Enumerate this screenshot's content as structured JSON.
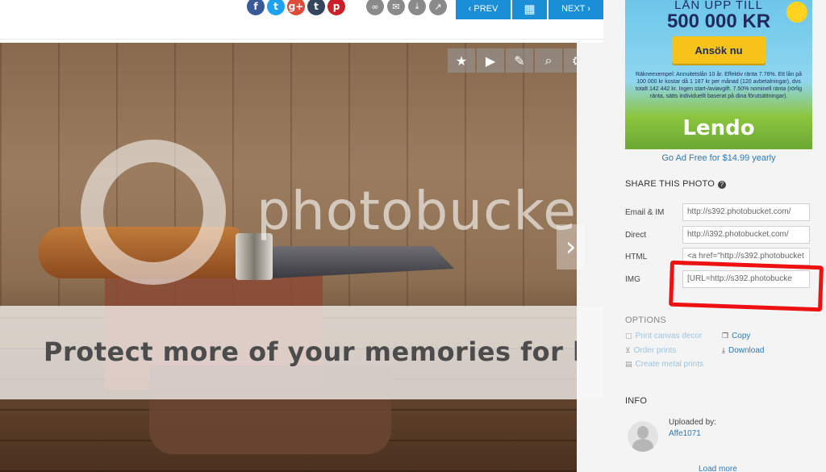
{
  "toolbar": {
    "social": [
      {
        "name": "facebook",
        "glyph": "f",
        "color": "#3b5998"
      },
      {
        "name": "twitter",
        "glyph": "t",
        "color": "#1da1f2"
      },
      {
        "name": "googleplus",
        "glyph": "g+",
        "color": "#dd4b39"
      },
      {
        "name": "tumblr",
        "glyph": "t",
        "color": "#35465c"
      },
      {
        "name": "pinterest",
        "glyph": "p",
        "color": "#cb2027"
      }
    ],
    "tools": [
      "link-icon",
      "email-icon",
      "download-icon",
      "share-icon"
    ],
    "prev_label": "‹ PREV",
    "next_label": "NEXT ›",
    "accent": "#1a8fd8"
  },
  "photo": {
    "watermark": "photobucket",
    "protect_banner": "Protect more of your memories for l"
  },
  "overlay_icons": [
    "star-icon",
    "play-icon",
    "edit-icon",
    "zoom-icon",
    "gear-icon"
  ],
  "ad": {
    "line1": "LÅN UPP TILL",
    "line2": "500 000 KR",
    "cta": "Ansök nu",
    "fine": "Räkneexempel: Annuitetslån 10 år. Effektiv ränta 7.76%. Ett lån på 100 000 kr kostar då 1 187 kr per månad (120 avbetalningar), dvs totalt 142 442 kr. Ingen start-/aviavgift. 7.50% nominell ränta (rörlig ränta, sätts individuellt baserat på dina förutsättningar).",
    "brand": "Lendo",
    "ad_free_link": "Go Ad Free for $14.99 yearly"
  },
  "share": {
    "heading": "SHARE THIS PHOTO",
    "rows": [
      {
        "label": "Email & IM",
        "value": "http://s392.photobucket.com/"
      },
      {
        "label": "Direct",
        "value": "http://i392.photobucket.com/"
      },
      {
        "label": "HTML",
        "value": "<a href=\"http://s392.photobucket"
      },
      {
        "label": "IMG",
        "value": "[URL=http://s392.photobucke"
      }
    ]
  },
  "options": {
    "heading": "OPTIONS",
    "left": [
      {
        "label": "Print canvas decor",
        "icon": "canvas-icon"
      },
      {
        "label": "Order prints",
        "icon": "cart-icon"
      },
      {
        "label": "Create metal prints",
        "icon": "metal-print-icon"
      }
    ],
    "right": [
      {
        "label": "Copy",
        "icon": "copy-icon"
      },
      {
        "label": "Download",
        "icon": "download-icon"
      }
    ]
  },
  "info": {
    "heading": "INFO",
    "uploaded_by_label": "Uploaded by:",
    "username": "Affe1071",
    "load_more": "Load more"
  }
}
